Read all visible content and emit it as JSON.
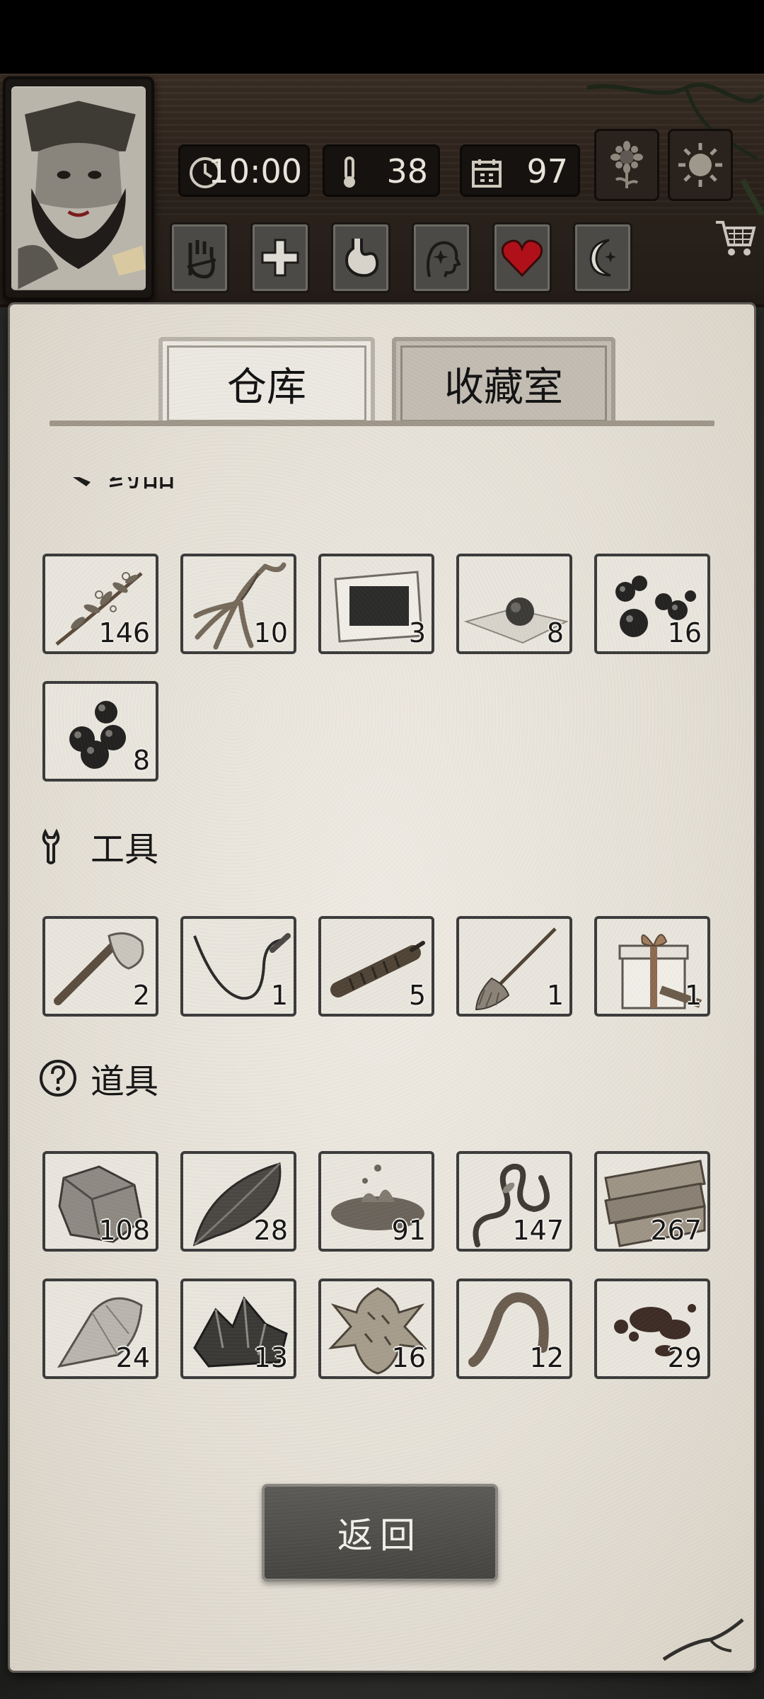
{
  "hud": {
    "time": "10:00",
    "temperature": "38",
    "day": "97",
    "status_icons": [
      "hand-bandage-icon",
      "first-aid-cross-icon",
      "stomach-icon",
      "head-sparkle-icon",
      "heart-icon",
      "crescent-moon-icon"
    ],
    "heart_color": "#b0101a"
  },
  "tabs": {
    "warehouse": "仓库",
    "collection": "收藏室"
  },
  "sections": {
    "medicine": {
      "label": "药品",
      "items": [
        {
          "icon": "herb-sprig-icon",
          "count": "146"
        },
        {
          "icon": "ginseng-root-icon",
          "count": "10"
        },
        {
          "icon": "plaster-patch-icon",
          "count": "3"
        },
        {
          "icon": "pill-on-paper-icon",
          "count": "8"
        },
        {
          "icon": "black-pills-icon",
          "count": "16"
        },
        {
          "icon": "berries-icon",
          "count": "8"
        }
      ]
    },
    "tools": {
      "label": "工具",
      "items": [
        {
          "icon": "stone-axe-icon",
          "count": "2"
        },
        {
          "icon": "whip-icon",
          "count": "1"
        },
        {
          "icon": "wrapped-handle-icon",
          "count": "5"
        },
        {
          "icon": "broom-icon",
          "count": "1"
        },
        {
          "icon": "gift-box-icon",
          "count": "1"
        }
      ]
    },
    "props": {
      "label": "道具",
      "items": [
        {
          "icon": "rock-icon",
          "count": "108"
        },
        {
          "icon": "leaf-icon",
          "count": "28"
        },
        {
          "icon": "mud-splash-icon",
          "count": "91"
        },
        {
          "icon": "vine-icon",
          "count": "147"
        },
        {
          "icon": "wood-planks-icon",
          "count": "267"
        },
        {
          "icon": "flint-icon",
          "count": "24"
        },
        {
          "icon": "ore-crystals-icon",
          "count": "13"
        },
        {
          "icon": "animal-hide-icon",
          "count": "16"
        },
        {
          "icon": "worm-icon",
          "count": "12"
        },
        {
          "icon": "blood-splatter-icon",
          "count": "29"
        }
      ]
    }
  },
  "back_button": "返回"
}
